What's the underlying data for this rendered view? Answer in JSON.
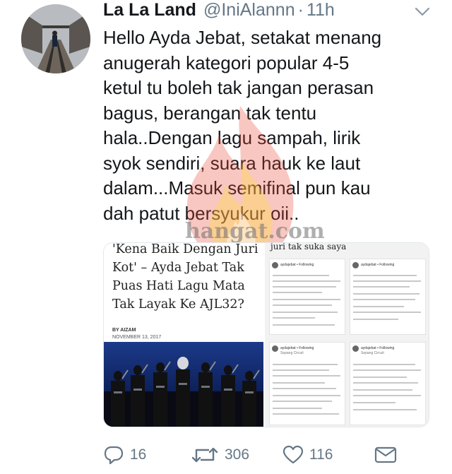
{
  "tweet": {
    "display_name": "La La Land",
    "handle": "@IniAlannn",
    "separator": "·",
    "time": "11h",
    "text": "Hello Ayda Jebat, setakat menang\nanugerah kategori popular 4-5\nketul tu boleh tak jangan perasan\nbagus, berangan tak tentu\nhala..Dengan lagu sampah, lirik\nsyok sendiri, suara hauk ke laut\ndalam...Masuk semifinal pun kau\ndah patut bersyukur oii.."
  },
  "watermark": {
    "text": "hangat.com"
  },
  "media": {
    "article_title": "'Kena Baik Dengan Juri\nKot' – Ayda Jebat Tak\nPuas Hati Lagu Mata\nTak Layak Ke AJL32?",
    "article_byline": "BY AIZAM",
    "article_date": "NOVEMBER 13, 2017",
    "right_header": "juri tak suka saya",
    "post_user": "aydajebat • Following",
    "post_location": "Sepang Circuit"
  },
  "actions": {
    "replies": "16",
    "retweets": "306",
    "likes": "116"
  },
  "colors": {
    "text": "#14171a",
    "secondary": "#657786",
    "border": "#e1e8ed"
  },
  "icons": [
    "chevron-down-icon",
    "reply-icon",
    "retweet-icon",
    "like-icon",
    "direct-message-icon",
    "flame-watermark-icon"
  ]
}
